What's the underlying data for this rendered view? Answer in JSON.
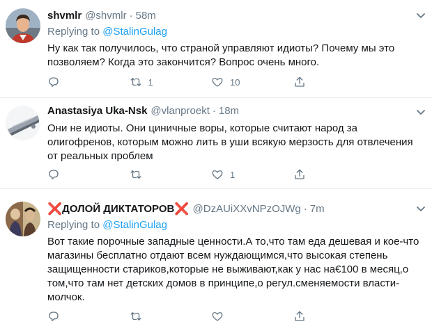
{
  "tweets": [
    {
      "name": "shvmlr",
      "handle": "@shvmlr",
      "time": "58m",
      "replying_prefix": "Replying to ",
      "replying_to": "@StalinGulag",
      "text": "Ну как так получилось, что страной управляют идиоты? Почему мы это позволяем? Когда это закончится? Вопрос очень много.",
      "reply_count": "",
      "retweet_count": "1",
      "like_count": "10"
    },
    {
      "name": "Anastasiya Uka-Nsk",
      "handle": "@vlanproekt",
      "time": "18m",
      "text": "Они не идиоты. Они циничные воры, которые считают народ за олигофренов, которым можно лить в уши всякую мерзость для отвлечения от реальных проблем",
      "reply_count": "",
      "retweet_count": "",
      "like_count": "1"
    },
    {
      "name_prefix_emoji": "❌",
      "name": "ДОЛОЙ ДИКТАТОРОВ",
      "name_suffix_emoji": "❌",
      "handle": "@DzAUiXXvNPzOJWg",
      "time": "7m",
      "replying_prefix": "Replying to ",
      "replying_to": "@StalinGulag",
      "text": "Вот такие порочные западные ценности.А то,что там еда дешевая и кое-что магазины бесплатно отдают всем нуждающимся,что высокая степень защищенности стариков,которые не выживают,как у нас на€100 в месяц,о том,что там нет детских домов в принципе,о регул.сменяемости власти-молчок.",
      "reply_count": "",
      "retweet_count": "",
      "like_count": ""
    }
  ],
  "separator": "·",
  "colors": {
    "link": "#1da1f2",
    "secondary_text": "#657786",
    "primary_text": "#14171a",
    "divider": "#e6ecf0",
    "emoji_red": "#dd2e44"
  },
  "icons": [
    "chevron-down-icon",
    "reply-icon",
    "retweet-icon",
    "like-icon",
    "share-icon"
  ]
}
